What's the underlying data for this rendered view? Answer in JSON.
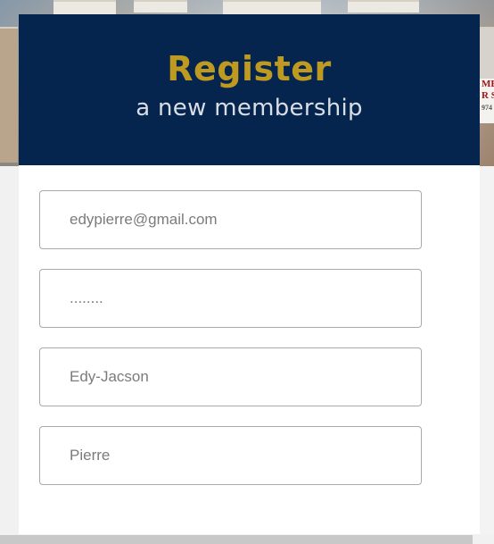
{
  "header": {
    "title": "Register",
    "subtitle": "a new membership"
  },
  "form": {
    "email_value": "edypierre@gmail.com",
    "password_value": "........",
    "first_name_value": "Edy-Jacson",
    "last_name_value": "Pierre"
  },
  "background": {
    "sign_text_line1": "ME",
    "sign_text_line2": "R S",
    "sign_text_line3": "974"
  },
  "colors": {
    "header_bg": "#05254f",
    "title": "#bf9a21",
    "subtitle": "#d9dde4"
  }
}
